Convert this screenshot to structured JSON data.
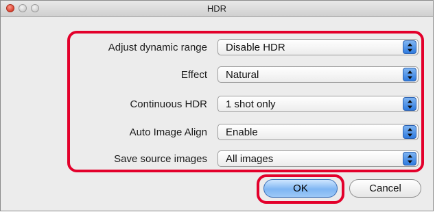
{
  "window": {
    "title": "HDR"
  },
  "fields": [
    {
      "label": "Adjust dynamic range",
      "value": "Disable HDR"
    },
    {
      "label": "Effect",
      "value": "Natural"
    },
    {
      "label": "Continuous HDR",
      "value": "1 shot only"
    },
    {
      "label": "Auto Image Align",
      "value": "Enable"
    },
    {
      "label": "Save source images",
      "value": "All images"
    }
  ],
  "buttons": {
    "ok": "OK",
    "cancel": "Cancel"
  },
  "colors": {
    "highlight": "#e3002b",
    "accent": "#2f7be0"
  },
  "icons": {
    "close": "close-icon",
    "minimize": "minimize-icon",
    "zoom": "zoom-icon",
    "stepper": "up-down-arrows-icon"
  }
}
